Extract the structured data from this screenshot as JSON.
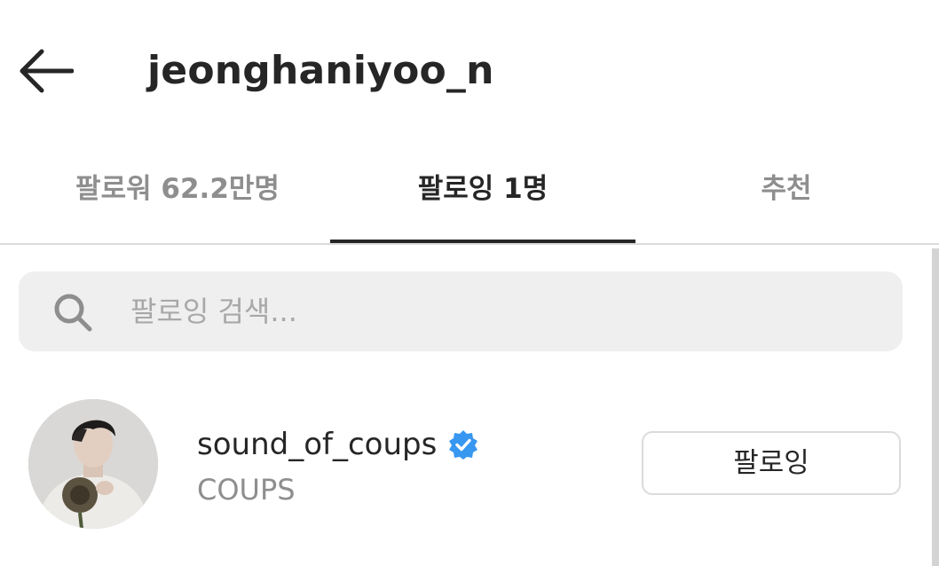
{
  "header": {
    "title": "jeonghaniyoo_n",
    "back_icon": "arrow-left-icon"
  },
  "tabs": [
    {
      "label": "팔로워 62.2만명",
      "active": false
    },
    {
      "label": "팔로잉 1명",
      "active": true
    },
    {
      "label": "추천",
      "active": false
    }
  ],
  "search": {
    "placeholder": "팔로잉 검색...",
    "value": "",
    "icon": "search-icon"
  },
  "following_list": [
    {
      "username": "sound_of_coups",
      "full_name": "COUPS",
      "verified": true,
      "button_label": "팔로잉"
    }
  ],
  "colors": {
    "text_primary": "#262626",
    "text_secondary": "#8e8e8e",
    "verified_blue": "#3897f0",
    "search_bg": "#efefef",
    "divider": "#dbdbdb"
  }
}
